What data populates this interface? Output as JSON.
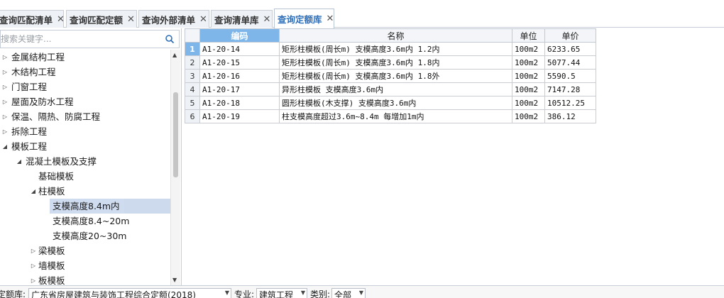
{
  "tabs": [
    {
      "label": "查询匹配清单",
      "active": false
    },
    {
      "label": "查询匹配定额",
      "active": false
    },
    {
      "label": "查询外部清单",
      "active": false
    },
    {
      "label": "查询清单库",
      "active": false
    },
    {
      "label": "查询定额库",
      "active": true
    }
  ],
  "search": {
    "placeholder": "搜索关键字..."
  },
  "tree": [
    {
      "label": "金属结构工程",
      "level": 0,
      "state": "collapsed"
    },
    {
      "label": "木结构工程",
      "level": 0,
      "state": "collapsed"
    },
    {
      "label": "门窗工程",
      "level": 0,
      "state": "collapsed"
    },
    {
      "label": "屋面及防水工程",
      "level": 0,
      "state": "collapsed"
    },
    {
      "label": "保温、隔热、防腐工程",
      "level": 0,
      "state": "collapsed"
    },
    {
      "label": "拆除工程",
      "level": 0,
      "state": "collapsed"
    },
    {
      "label": "模板工程",
      "level": 0,
      "state": "expanded"
    },
    {
      "label": "混凝土模板及支撑",
      "level": 1,
      "state": "expanded"
    },
    {
      "label": "基础模板",
      "level": 2,
      "state": "leaf"
    },
    {
      "label": "柱模板",
      "level": 2,
      "state": "expanded"
    },
    {
      "label": "支模高度8.4m内",
      "level": 3,
      "state": "leaf",
      "selected": true
    },
    {
      "label": "支模高度8.4~20m",
      "level": 3,
      "state": "leaf"
    },
    {
      "label": "支模高度20~30m",
      "level": 3,
      "state": "leaf"
    },
    {
      "label": "梁模板",
      "level": 2,
      "state": "collapsed"
    },
    {
      "label": "墙模板",
      "level": 2,
      "state": "collapsed"
    },
    {
      "label": "板模板",
      "level": 2,
      "state": "collapsed"
    }
  ],
  "table": {
    "columns": [
      "编码",
      "名称",
      "单位",
      "单价"
    ],
    "rows": [
      {
        "num": "1",
        "code": "A1-20-14",
        "name": "矩形柱模板(周长m) 支模高度3.6m内 1.2内",
        "unit": "100m2",
        "price": "6233.65"
      },
      {
        "num": "2",
        "code": "A1-20-15",
        "name": "矩形柱模板(周长m) 支模高度3.6m内 1.8内",
        "unit": "100m2",
        "price": "5077.44"
      },
      {
        "num": "3",
        "code": "A1-20-16",
        "name": "矩形柱模板(周长m) 支模高度3.6m内 1.8外",
        "unit": "100m2",
        "price": "5590.5"
      },
      {
        "num": "4",
        "code": "A1-20-17",
        "name": "异形柱模板 支模高度3.6m内",
        "unit": "100m2",
        "price": "7147.28"
      },
      {
        "num": "5",
        "code": "A1-20-18",
        "name": "圆形柱模板(木支撑) 支模高度3.6m内",
        "unit": "100m2",
        "price": "10512.25"
      },
      {
        "num": "6",
        "code": "A1-20-19",
        "name": "柱支模高度超过3.6m~8.4m 每增加1m内",
        "unit": "100m2",
        "price": "386.12"
      }
    ]
  },
  "bottom": {
    "library_label": "定额库:",
    "library_value": "广东省房屋建筑与装饰工程综合定额(2018)",
    "major_label": "专业:",
    "major_value": "建筑工程",
    "category_label": "类别:",
    "category_value": "全部"
  },
  "colors": {
    "accent": "#7eb6ea",
    "active_tab": "#2f6fb9",
    "selection": "#cddaee"
  }
}
